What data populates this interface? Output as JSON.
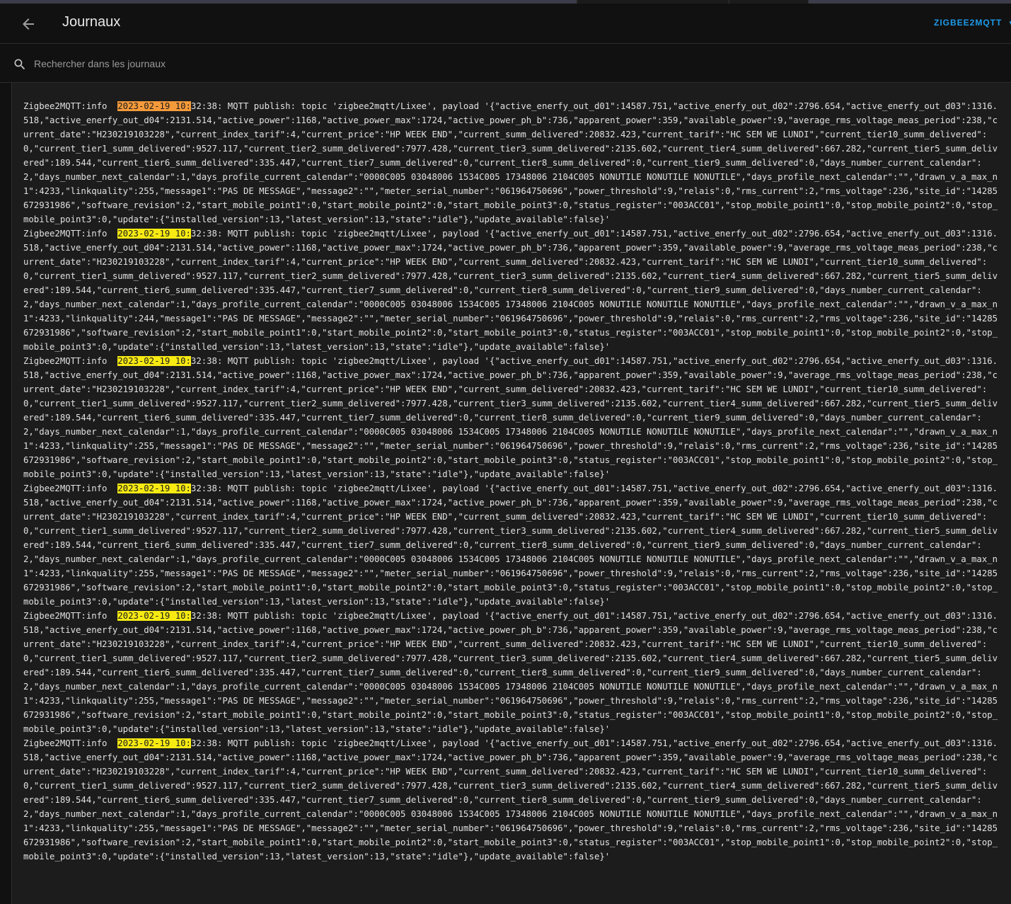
{
  "header": {
    "title": "Journaux",
    "source": "ZIGBEE2MQTT"
  },
  "search": {
    "placeholder": "Rechercher dans les journaux"
  },
  "colors": {
    "accent": "#1e9be9",
    "highlight": "#f7ea12",
    "highlight_active": "#f59a3a"
  },
  "log": {
    "payload": "'{\"active_enerfy_out_d01\":14587.751,\"active_enerfy_out_d02\":2796.654,\"active_enerfy_out_d03\":1316.518,\"active_enerfy_out_d04\":2131.514,\"active_power\":1168,\"active_power_max\":1724,\"active_power_ph_b\":736,\"apparent_power\":359,\"available_power\":9,\"average_rms_voltage_meas_period\":238,\"current_date\":\"H230219103228\",\"current_index_tarif\":4,\"current_price\":\"HP WEEK END\",\"current_summ_delivered\":20832.423,\"current_tarif\":\"HC SEM WE LUNDI\",\"current_tier10_summ_delivered\":0,\"current_tier1_summ_delivered\":9527.117,\"current_tier2_summ_delivered\":7977.428,\"current_tier3_summ_delivered\":2135.602,\"current_tier4_summ_delivered\":667.282,\"current_tier5_summ_delivered\":189.544,\"current_tier6_summ_delivered\":335.447,\"current_tier7_summ_delivered\":0,\"current_tier8_summ_delivered\":0,\"current_tier9_summ_delivered\":0,\"days_number_current_calendar\":2,\"days_number_next_calendar\":1,\"days_profile_current_calendar\":\"0000C005 03048006 1534C005 17348006 2104C005 NONUTILE NONUTILE NONUTILE\",\"days_profile_next_calendar\":\"\",\"drawn_v_a_max_n1\":4233,\"linkquality\":255,\"message1\":\"PAS DE MESSAGE\",\"message2\":\"\",\"meter_serial_number\":\"061964750696\",\"power_threshold\":9,\"relais\":0,\"rms_current\":2,\"rms_voltage\":236,\"site_id\":\"14285672931986\",\"software_revision\":2,\"start_mobile_point1\":0,\"start_mobile_point2\":0,\"start_mobile_point3\":0,\"status_register\":\"003ACC01\",\"stop_mobile_point1\":0,\"stop_mobile_point2\":0,\"stop_mobile_point3\":0,\"update\":{\"installed_version\":13,\"latest_version\":13,\"state\":\"idle\"},\"update_available\":false}'",
    "payload_lq244": "'{\"active_enerfy_out_d01\":14587.751,\"active_enerfy_out_d02\":2796.654,\"active_enerfy_out_d03\":1316.518,\"active_enerfy_out_d04\":2131.514,\"active_power\":1168,\"active_power_max\":1724,\"active_power_ph_b\":736,\"apparent_power\":359,\"available_power\":9,\"average_rms_voltage_meas_period\":238,\"current_date\":\"H230219103228\",\"current_index_tarif\":4,\"current_price\":\"HP WEEK END\",\"current_summ_delivered\":20832.423,\"current_tarif\":\"HC SEM WE LUNDI\",\"current_tier10_summ_delivered\":0,\"current_tier1_summ_delivered\":9527.117,\"current_tier2_summ_delivered\":7977.428,\"current_tier3_summ_delivered\":2135.602,\"current_tier4_summ_delivered\":667.282,\"current_tier5_summ_delivered\":189.544,\"current_tier6_summ_delivered\":335.447,\"current_tier7_summ_delivered\":0,\"current_tier8_summ_delivered\":0,\"current_tier9_summ_delivered\":0,\"days_number_current_calendar\":2,\"days_number_next_calendar\":1,\"days_profile_current_calendar\":\"0000C005 03048006 1534C005 17348006 2104C005 NONUTILE NONUTILE NONUTILE\",\"days_profile_next_calendar\":\"\",\"drawn_v_a_max_n1\":4233,\"linkquality\":244,\"message1\":\"PAS DE MESSAGE\",\"message2\":\"\",\"meter_serial_number\":\"061964750696\",\"power_threshold\":9,\"relais\":0,\"rms_current\":2,\"rms_voltage\":236,\"site_id\":\"14285672931986\",\"software_revision\":2,\"start_mobile_point1\":0,\"start_mobile_point2\":0,\"start_mobile_point3\":0,\"status_register\":\"003ACC01\",\"stop_mobile_point1\":0,\"stop_mobile_point2\":0,\"stop_mobile_point3\":0,\"update\":{\"installed_version\":13,\"latest_version\":13,\"state\":\"idle\"},\"update_available\":false}'",
    "entries": [
      {
        "prefix": "Zigbee2MQTT:info  ",
        "match": "2023-02-19 10:",
        "rest": "32:38: MQTT publish: topic 'zigbee2mqtt/Lixee', payload ",
        "active": true
      },
      {
        "prefix": "Zigbee2MQTT:info  ",
        "match": "2023-02-19 10:",
        "rest": "32:38: MQTT publish: topic 'zigbee2mqtt/Lixee', payload ",
        "active": false,
        "lq244": true
      },
      {
        "prefix": "Zigbee2MQTT:info  ",
        "match": "2023-02-19 10:",
        "rest": "32:38: MQTT publish: topic 'zigbee2mqtt/Lixee', payload ",
        "active": false
      },
      {
        "prefix": "Zigbee2MQTT:info  ",
        "match": "2023-02-19 10:",
        "rest": "32:38: MQTT publish: topic 'zigbee2mqtt/Lixee', payload ",
        "active": false
      },
      {
        "prefix": "Zigbee2MQTT:info  ",
        "match": "2023-02-19 10:",
        "rest": "32:38: MQTT publish: topic 'zigbee2mqtt/Lixee', payload ",
        "active": false
      },
      {
        "prefix": "Zigbee2MQTT:info  ",
        "match": "2023-02-19 10:",
        "rest": "32:38: MQTT publish: topic 'zigbee2mqtt/Lixee', payload ",
        "active": false
      }
    ]
  }
}
